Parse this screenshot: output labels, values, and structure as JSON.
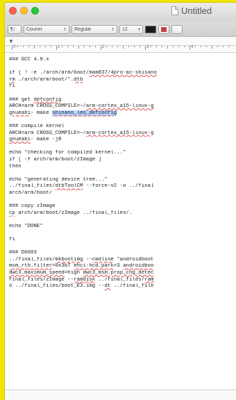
{
  "window": {
    "title": "Untitled"
  },
  "toolbar": {
    "paragraph_style": "¶↕",
    "font_family": "Courier",
    "font_style": "Regular",
    "font_size": "12",
    "text_color": "#1a1a1a"
  },
  "ruler": {
    "numbers": [
      "0",
      "1",
      "2",
      "3",
      "4"
    ]
  },
  "editor": {
    "lines": [
      [
        {
          "t": "### GCC 4.9.x"
        }
      ],
      [],
      [
        {
          "t": "if [ ! -e ./arch/arm/boot/"
        },
        {
          "t": "mam837/4pro-ac-shisano",
          "s": 1
        }
      ],
      [
        {
          "t": "rm",
          "s": 1
        },
        {
          "t": " ./arch/arm/boot/*."
        },
        {
          "t": "dtb",
          "s": 1
        }
      ],
      [
        {
          "t": "fi"
        }
      ],
      [],
      [
        {
          "t": "### get "
        },
        {
          "t": "defconfig",
          "s": 1
        }
      ],
      [
        {
          "t": "ARCH=arm CROSS_COMPILE=~/"
        },
        {
          "t": "arm-cortex_a15-linux-g",
          "s": 1
        }
      ],
      [
        {
          "t": "gnueabi",
          "s": 1
        },
        {
          "t": "- make "
        },
        {
          "t": "shinano_leo_defconfig",
          "s": 1,
          "h": 1
        }
      ],
      [],
      [
        {
          "t": "### compile kernel"
        }
      ],
      [
        {
          "t": "ARCH=arm CROSS_COMPILE=~/"
        },
        {
          "t": "arm-cortex_a15-linux-g",
          "s": 1
        }
      ],
      [
        {
          "t": "gnueabi",
          "s": 1
        },
        {
          "t": "- make -j8"
        }
      ],
      [],
      [
        {
          "t": "echo \"checking for compiled kernel...\""
        }
      ],
      [
        {
          "t": "if [ -f arch/arm/boot/zImage ]"
        }
      ],
      [
        {
          "t": "then"
        }
      ],
      [],
      [
        {
          "t": "echo \"generating device tree...\""
        }
      ],
      [
        {
          "t": "../final_files/"
        },
        {
          "t": "dtbToolCM",
          "s": 1
        },
        {
          "t": " --force-v2 -o ../final"
        }
      ],
      [
        {
          "t": "arch/arm/boot/"
        }
      ],
      [],
      [
        {
          "t": "### copy zImage"
        }
      ],
      [
        {
          "t": "cp",
          "s": 1
        },
        {
          "t": " arch/arm/boot/zImage ../final_files/."
        }
      ],
      [],
      [
        {
          "t": "echo \"DONE\""
        }
      ],
      [],
      [
        {
          "t": "fi"
        }
      ],
      [],
      [
        {
          "t": "### D6603"
        }
      ],
      [
        {
          "t": "../final_files/"
        },
        {
          "t": "mkbootimg",
          "s": 1
        },
        {
          "t": " --"
        },
        {
          "t": "cmdline",
          "s": 1
        },
        {
          "t": " \"androidboot"
        }
      ],
      [
        {
          "t": "msm_rtb.filter",
          "s": 1
        },
        {
          "t": "=0x3b7 "
        },
        {
          "t": "ehci-hcd.park",
          "s": 1
        },
        {
          "t": "=3 "
        },
        {
          "t": "androidboo",
          "s": 1
        }
      ],
      [
        {
          "t": "dwc3.maximum_speed",
          "s": 1
        },
        {
          "t": "=high "
        },
        {
          "t": "dwc3_msm.prop_chg_detec",
          "s": 1
        }
      ],
      [
        {
          "t": "final_files/zImage --"
        },
        {
          "t": "ramdisk",
          "s": 1
        },
        {
          "t": " ../final_files/"
        },
        {
          "t": "ram",
          "s": 1
        }
      ],
      [
        {
          "t": "o ../final_files/boot_E3.img --"
        },
        {
          "t": "dt",
          "s": 1
        },
        {
          "t": " ../final_file"
        }
      ]
    ]
  }
}
